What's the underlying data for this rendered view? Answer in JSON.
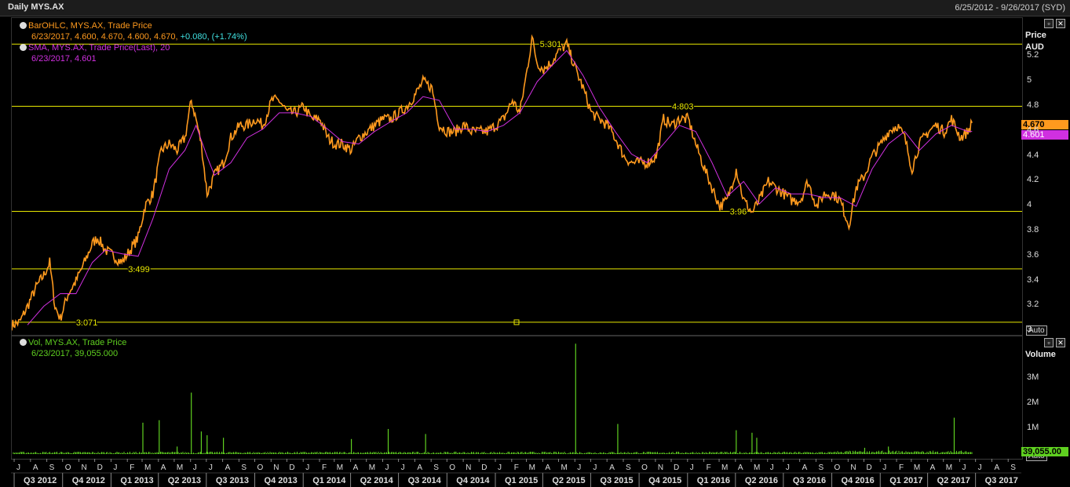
{
  "window": {
    "title": "Daily MYS.AX",
    "date_range": "6/25/2012 - 9/26/2017 (SYD)"
  },
  "price_legend": {
    "line1": "BarOHLC, MYS.AX, Trade Price",
    "line2_values": "6/23/2017, 4.600, 4.670, 4.600, 4.670,",
    "line2_change": " +0.080, (+1.74%)",
    "line3": "SMA, MYS.AX, Trade Price(Last),",
    "line3_period": "20",
    "line4": "6/23/2017, 4.601"
  },
  "vol_legend": {
    "line1": "Vol, MYS.AX, Trade Price",
    "line2": "6/23/2017, 39,055.000"
  },
  "price_axis": {
    "title": "Price",
    "unit": "AUD",
    "last_price": "4.670",
    "sma_value": "4.601",
    "auto": "Auto"
  },
  "vol_axis": {
    "title": "Volume",
    "last_vol": "39,055.00",
    "auto": "Auto"
  },
  "colors": {
    "price": "#ff9a1e",
    "sma": "#d030e0",
    "hline": "#e8e800",
    "volume": "#5fd020",
    "legend_orange": "#ff9a1e",
    "legend_cyan": "#40e0e0",
    "legend_green": "#5fd020"
  },
  "chart_data": [
    {
      "type": "line",
      "title": "",
      "ylabel": "Price AUD",
      "ylim": [
        2.97,
        5.51
      ],
      "yticks": [
        "5.2",
        "5",
        "4.8",
        "4.6",
        "4.4",
        "4.2",
        "4",
        "3.8",
        "3.6",
        "3.4",
        "3.2",
        "3"
      ],
      "hlines": [
        {
          "value": 5.301,
          "label": "5.301"
        },
        {
          "value": 4.803,
          "label": "4.803"
        },
        {
          "value": 3.96,
          "label": "3.96"
        },
        {
          "value": 3.499,
          "label": "3.499"
        },
        {
          "value": 3.071,
          "label": "3.071"
        }
      ],
      "series": [
        {
          "key": "price",
          "values": [
            [
              "2012-06-25",
              3.05
            ],
            [
              "2012-07-10",
              3.07
            ],
            [
              "2012-07-25",
              3.2
            ],
            [
              "2012-08-10",
              3.35
            ],
            [
              "2012-08-25",
              3.45
            ],
            [
              "2012-09-05",
              3.55
            ],
            [
              "2012-09-15",
              3.2
            ],
            [
              "2012-09-25",
              3.1
            ],
            [
              "2012-10-10",
              3.3
            ],
            [
              "2012-10-25",
              3.4
            ],
            [
              "2012-11-10",
              3.55
            ],
            [
              "2012-11-25",
              3.7
            ],
            [
              "2012-12-05",
              3.75
            ],
            [
              "2012-12-20",
              3.65
            ],
            [
              "2013-01-05",
              3.6
            ],
            [
              "2013-01-20",
              3.55
            ],
            [
              "2013-02-05",
              3.65
            ],
            [
              "2013-02-20",
              3.75
            ],
            [
              "2013-03-05",
              4.0
            ],
            [
              "2013-03-20",
              4.1
            ],
            [
              "2013-04-05",
              4.45
            ],
            [
              "2013-04-20",
              4.5
            ],
            [
              "2013-05-05",
              4.45
            ],
            [
              "2013-05-20",
              4.55
            ],
            [
              "2013-06-01",
              4.85
            ],
            [
              "2013-06-10",
              4.7
            ],
            [
              "2013-06-20",
              4.5
            ],
            [
              "2013-07-01",
              4.1
            ],
            [
              "2013-07-15",
              4.25
            ],
            [
              "2013-08-01",
              4.35
            ],
            [
              "2013-08-15",
              4.55
            ],
            [
              "2013-09-01",
              4.65
            ],
            [
              "2013-09-15",
              4.65
            ],
            [
              "2013-10-01",
              4.7
            ],
            [
              "2013-10-15",
              4.65
            ],
            [
              "2013-11-01",
              4.85
            ],
            [
              "2013-11-15",
              4.85
            ],
            [
              "2013-12-01",
              4.75
            ],
            [
              "2013-12-15",
              4.75
            ],
            [
              "2014-01-01",
              4.8
            ],
            [
              "2014-01-15",
              4.7
            ],
            [
              "2014-02-01",
              4.7
            ],
            [
              "2014-02-15",
              4.55
            ],
            [
              "2014-03-01",
              4.5
            ],
            [
              "2014-03-15",
              4.5
            ],
            [
              "2014-04-01",
              4.45
            ],
            [
              "2014-04-15",
              4.55
            ],
            [
              "2014-05-01",
              4.6
            ],
            [
              "2014-05-15",
              4.65
            ],
            [
              "2014-06-01",
              4.7
            ],
            [
              "2014-06-15",
              4.7
            ],
            [
              "2014-07-01",
              4.75
            ],
            [
              "2014-07-15",
              4.8
            ],
            [
              "2014-08-01",
              4.9
            ],
            [
              "2014-08-15",
              5.0
            ],
            [
              "2014-09-01",
              4.95
            ],
            [
              "2014-09-15",
              4.65
            ],
            [
              "2014-10-01",
              4.6
            ],
            [
              "2014-10-15",
              4.6
            ],
            [
              "2014-11-01",
              4.65
            ],
            [
              "2014-11-15",
              4.6
            ],
            [
              "2014-12-01",
              4.6
            ],
            [
              "2014-12-15",
              4.6
            ],
            [
              "2015-01-01",
              4.65
            ],
            [
              "2015-01-15",
              4.7
            ],
            [
              "2015-02-01",
              4.85
            ],
            [
              "2015-02-15",
              4.75
            ],
            [
              "2015-03-01",
              5.1
            ],
            [
              "2015-03-10",
              5.35
            ],
            [
              "2015-03-20",
              5.15
            ],
            [
              "2015-04-01",
              5.1
            ],
            [
              "2015-04-15",
              5.15
            ],
            [
              "2015-05-01",
              5.25
            ],
            [
              "2015-05-15",
              5.3
            ],
            [
              "2015-06-01",
              5.1
            ],
            [
              "2015-06-15",
              4.95
            ],
            [
              "2015-07-01",
              4.75
            ],
            [
              "2015-07-15",
              4.7
            ],
            [
              "2015-08-01",
              4.65
            ],
            [
              "2015-08-15",
              4.55
            ],
            [
              "2015-09-01",
              4.4
            ],
            [
              "2015-09-15",
              4.35
            ],
            [
              "2015-10-01",
              4.35
            ],
            [
              "2015-10-15",
              4.35
            ],
            [
              "2015-11-01",
              4.4
            ],
            [
              "2015-11-15",
              4.7
            ],
            [
              "2015-12-01",
              4.65
            ],
            [
              "2015-12-15",
              4.7
            ],
            [
              "2016-01-01",
              4.7
            ],
            [
              "2016-01-15",
              4.5
            ],
            [
              "2016-02-01",
              4.3
            ],
            [
              "2016-02-15",
              4.15
            ],
            [
              "2016-03-01",
              4.0
            ],
            [
              "2016-03-15",
              4.05
            ],
            [
              "2016-04-01",
              4.3
            ],
            [
              "2016-04-15",
              4.05
            ],
            [
              "2016-05-01",
              3.95
            ],
            [
              "2016-05-15",
              4.05
            ],
            [
              "2016-06-01",
              4.2
            ],
            [
              "2016-06-15",
              4.15
            ],
            [
              "2016-07-01",
              4.1
            ],
            [
              "2016-07-15",
              4.05
            ],
            [
              "2016-08-01",
              4.05
            ],
            [
              "2016-08-15",
              4.2
            ],
            [
              "2016-09-01",
              4.0
            ],
            [
              "2016-09-15",
              4.1
            ],
            [
              "2016-10-01",
              4.1
            ],
            [
              "2016-10-15",
              4.05
            ],
            [
              "2016-11-01",
              3.85
            ],
            [
              "2016-11-15",
              4.15
            ],
            [
              "2016-12-01",
              4.25
            ],
            [
              "2016-12-15",
              4.4
            ],
            [
              "2017-01-01",
              4.5
            ],
            [
              "2017-01-15",
              4.6
            ],
            [
              "2017-02-01",
              4.65
            ],
            [
              "2017-02-15",
              4.55
            ],
            [
              "2017-03-01",
              4.3
            ],
            [
              "2017-03-15",
              4.5
            ],
            [
              "2017-04-01",
              4.6
            ],
            [
              "2017-04-15",
              4.65
            ],
            [
              "2017-05-01",
              4.6
            ],
            [
              "2017-05-15",
              4.7
            ],
            [
              "2017-06-01",
              4.55
            ],
            [
              "2017-06-15",
              4.6
            ],
            [
              "2017-06-23",
              4.67
            ]
          ]
        },
        {
          "key": "sma",
          "values": [
            [
              "2012-07-25",
              3.05
            ],
            [
              "2012-08-25",
              3.2
            ],
            [
              "2012-09-25",
              3.3
            ],
            [
              "2012-10-25",
              3.3
            ],
            [
              "2012-11-25",
              3.55
            ],
            [
              "2012-12-20",
              3.65
            ],
            [
              "2013-01-20",
              3.62
            ],
            [
              "2013-02-20",
              3.6
            ],
            [
              "2013-03-20",
              3.9
            ],
            [
              "2013-04-20",
              4.3
            ],
            [
              "2013-05-20",
              4.45
            ],
            [
              "2013-06-10",
              4.65
            ],
            [
              "2013-07-01",
              4.4
            ],
            [
              "2013-07-15",
              4.25
            ],
            [
              "2013-08-15",
              4.35
            ],
            [
              "2013-09-15",
              4.55
            ],
            [
              "2013-10-15",
              4.62
            ],
            [
              "2013-11-15",
              4.75
            ],
            [
              "2013-12-15",
              4.75
            ],
            [
              "2014-01-15",
              4.72
            ],
            [
              "2014-02-15",
              4.62
            ],
            [
              "2014-03-15",
              4.52
            ],
            [
              "2014-04-15",
              4.5
            ],
            [
              "2014-05-15",
              4.6
            ],
            [
              "2014-06-15",
              4.68
            ],
            [
              "2014-07-15",
              4.75
            ],
            [
              "2014-08-15",
              4.88
            ],
            [
              "2014-09-15",
              4.85
            ],
            [
              "2014-10-15",
              4.62
            ],
            [
              "2014-11-15",
              4.62
            ],
            [
              "2014-12-15",
              4.6
            ],
            [
              "2015-01-15",
              4.65
            ],
            [
              "2015-02-15",
              4.75
            ],
            [
              "2015-03-20",
              5.0
            ],
            [
              "2015-04-15",
              5.12
            ],
            [
              "2015-05-15",
              5.25
            ],
            [
              "2015-06-15",
              5.05
            ],
            [
              "2015-07-15",
              4.8
            ],
            [
              "2015-08-15",
              4.6
            ],
            [
              "2015-09-15",
              4.42
            ],
            [
              "2015-10-15",
              4.35
            ],
            [
              "2015-11-15",
              4.5
            ],
            [
              "2015-12-15",
              4.65
            ],
            [
              "2016-01-15",
              4.6
            ],
            [
              "2016-02-15",
              4.35
            ],
            [
              "2016-03-15",
              4.08
            ],
            [
              "2016-04-15",
              4.2
            ],
            [
              "2016-05-15",
              4.02
            ],
            [
              "2016-06-15",
              4.15
            ],
            [
              "2016-07-15",
              4.1
            ],
            [
              "2016-08-15",
              4.1
            ],
            [
              "2016-09-15",
              4.07
            ],
            [
              "2016-10-15",
              4.07
            ],
            [
              "2016-11-15",
              4.0
            ],
            [
              "2016-12-15",
              4.3
            ],
            [
              "2017-01-15",
              4.5
            ],
            [
              "2017-02-15",
              4.6
            ],
            [
              "2017-03-15",
              4.45
            ],
            [
              "2017-04-15",
              4.58
            ],
            [
              "2017-05-15",
              4.65
            ],
            [
              "2017-06-15",
              4.6
            ],
            [
              "2017-06-23",
              4.601
            ]
          ]
        }
      ],
      "x_month_ticks": [
        "J",
        "A",
        "S",
        "O",
        "N",
        "D",
        "J",
        "F",
        "M",
        "A",
        "M",
        "J",
        "J",
        "A",
        "S",
        "O",
        "N",
        "D",
        "J",
        "F",
        "M",
        "A",
        "M",
        "J",
        "J",
        "A",
        "S",
        "O",
        "N",
        "D",
        "J",
        "F",
        "M",
        "A",
        "M",
        "J",
        "J",
        "A",
        "S",
        "O",
        "N",
        "D",
        "J",
        "F",
        "M",
        "A",
        "M",
        "J",
        "J",
        "A",
        "S",
        "O",
        "N",
        "D",
        "J",
        "F",
        "M",
        "A",
        "M",
        "J",
        "J",
        "A",
        "S"
      ],
      "x_quarter_ticks": [
        "Q3 2012",
        "Q4 2012",
        "Q1 2013",
        "Q2 2013",
        "Q3 2013",
        "Q4 2013",
        "Q1 2014",
        "Q2 2014",
        "Q3 2014",
        "Q4 2014",
        "Q1 2015",
        "Q2 2015",
        "Q3 2015",
        "Q4 2015",
        "Q1 2016",
        "Q2 2016",
        "Q3 2016",
        "Q4 2016",
        "Q1 2017",
        "Q2 2017",
        "Q3 2017"
      ],
      "x_range": [
        "2012-06-25",
        "2017-09-26"
      ]
    },
    {
      "type": "bar",
      "ylabel": "Volume",
      "ylim": [
        0,
        4500000
      ],
      "yticks": [
        "3M",
        "2M",
        "1M"
      ],
      "baseline": 60000,
      "spikes": [
        [
          "2013-03-01",
          1250000
        ],
        [
          "2013-04-01",
          1350000
        ],
        [
          "2013-05-05",
          300000
        ],
        [
          "2013-06-01",
          2450000
        ],
        [
          "2013-06-20",
          900000
        ],
        [
          "2013-07-01",
          750000
        ],
        [
          "2013-08-01",
          650000
        ],
        [
          "2014-04-01",
          600000
        ],
        [
          "2014-06-10",
          1000000
        ],
        [
          "2014-08-20",
          800000
        ],
        [
          "2015-06-01",
          4400000
        ],
        [
          "2015-08-20",
          1200000
        ],
        [
          "2016-04-01",
          950000
        ],
        [
          "2016-05-01",
          850000
        ],
        [
          "2016-05-10",
          650000
        ],
        [
          "2017-05-20",
          1450000
        ],
        [
          "2016-12-01",
          250000
        ],
        [
          "2017-01-15",
          300000
        ]
      ]
    }
  ]
}
